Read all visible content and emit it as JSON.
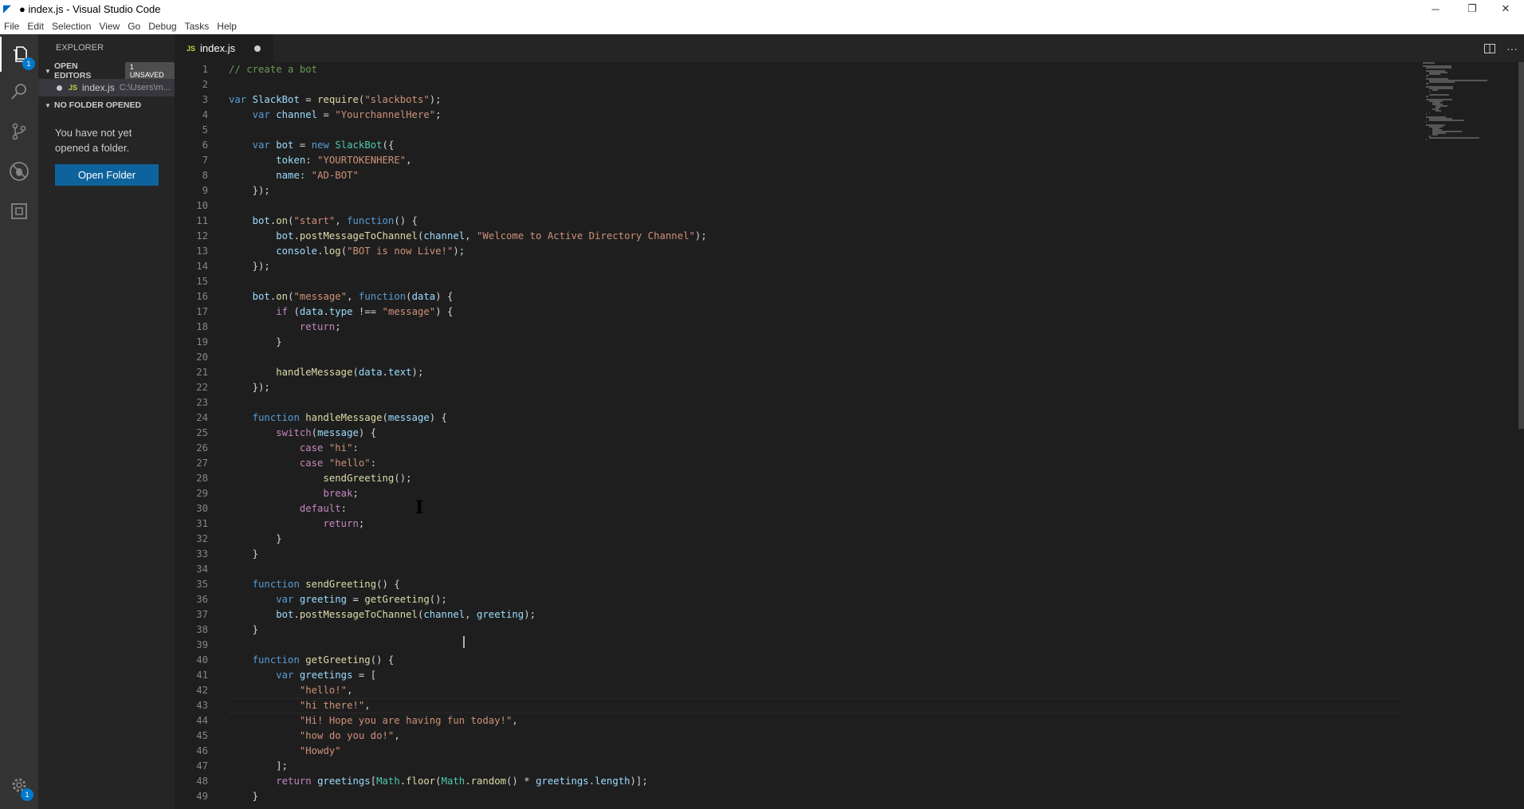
{
  "window": {
    "title": "● index.js - Visual Studio Code",
    "controls": {
      "minimize": "─",
      "maximize": "❐",
      "close": "✕"
    }
  },
  "menu": [
    "File",
    "Edit",
    "Selection",
    "View",
    "Go",
    "Debug",
    "Tasks",
    "Help"
  ],
  "activity_bar": {
    "items": [
      "files-icon",
      "search-icon",
      "source-control-icon",
      "debug-icon",
      "extensions-icon"
    ],
    "explorer_badge": "1",
    "settings_badge": "1"
  },
  "sidebar": {
    "title": "EXPLORER",
    "open_editors_label": "OPEN EDITORS",
    "unsaved_badge": "1 UNSAVED",
    "open_file": {
      "badge": "JS",
      "name": "index.js",
      "path": "C:\\Users\\m..."
    },
    "no_folder_label": "NO FOLDER OPENED",
    "no_folder_message": "You have not yet opened a folder.",
    "open_folder_button": "Open Folder"
  },
  "tab": {
    "badge": "JS",
    "name": "index.js"
  },
  "editor": {
    "lines": [
      [
        [
          "c-comment",
          "// create a bot"
        ]
      ],
      [],
      [
        [
          "c-kw",
          "var "
        ],
        [
          "c-var",
          "SlackBot"
        ],
        [
          "",
          " = "
        ],
        [
          "c-fn",
          "require"
        ],
        [
          "",
          "("
        ],
        [
          "c-str",
          "\"slackbots\""
        ],
        [
          "",
          ");"
        ]
      ],
      [
        [
          "",
          "    "
        ],
        [
          "c-kw",
          "var "
        ],
        [
          "c-var",
          "channel"
        ],
        [
          "",
          " = "
        ],
        [
          "c-str",
          "\"YourchannelHere\""
        ],
        [
          "",
          ";"
        ]
      ],
      [],
      [
        [
          "",
          "    "
        ],
        [
          "c-kw",
          "var "
        ],
        [
          "c-var",
          "bot"
        ],
        [
          "",
          " = "
        ],
        [
          "c-kw",
          "new "
        ],
        [
          "c-type",
          "SlackBot"
        ],
        [
          "",
          "({"
        ]
      ],
      [
        [
          "",
          "        "
        ],
        [
          "c-var",
          "token"
        ],
        [
          "",
          ": "
        ],
        [
          "c-str",
          "\"YOURTOKENHERE\""
        ],
        [
          "",
          ","
        ]
      ],
      [
        [
          "",
          "        "
        ],
        [
          "c-var",
          "name"
        ],
        [
          "",
          ": "
        ],
        [
          "c-str",
          "\"AD-BOT\""
        ]
      ],
      [
        [
          "",
          "    });"
        ]
      ],
      [],
      [
        [
          "",
          "    "
        ],
        [
          "c-var",
          "bot"
        ],
        [
          "",
          "."
        ],
        [
          "c-fn",
          "on"
        ],
        [
          "",
          "("
        ],
        [
          "c-str",
          "\"start\""
        ],
        [
          "",
          ", "
        ],
        [
          "c-kw",
          "function"
        ],
        [
          "",
          "() {"
        ]
      ],
      [
        [
          "",
          "        "
        ],
        [
          "c-var",
          "bot"
        ],
        [
          "",
          "."
        ],
        [
          "c-fn",
          "postMessageToChannel"
        ],
        [
          "",
          "("
        ],
        [
          "c-var",
          "channel"
        ],
        [
          "",
          ", "
        ],
        [
          "c-str",
          "\"Welcome to Active Directory Channel\""
        ],
        [
          "",
          ");"
        ]
      ],
      [
        [
          "",
          "        "
        ],
        [
          "c-var",
          "console"
        ],
        [
          "",
          "."
        ],
        [
          "c-fn",
          "log"
        ],
        [
          "",
          "("
        ],
        [
          "c-str",
          "\"BOT is now Live!\""
        ],
        [
          "",
          ");"
        ]
      ],
      [
        [
          "",
          "    });"
        ]
      ],
      [],
      [
        [
          "",
          "    "
        ],
        [
          "c-var",
          "bot"
        ],
        [
          "",
          "."
        ],
        [
          "c-fn",
          "on"
        ],
        [
          "",
          "("
        ],
        [
          "c-str",
          "\"message\""
        ],
        [
          "",
          ", "
        ],
        [
          "c-kw",
          "function"
        ],
        [
          "",
          "("
        ],
        [
          "c-var",
          "data"
        ],
        [
          "",
          ") {"
        ]
      ],
      [
        [
          "",
          "        "
        ],
        [
          "c-ctrl",
          "if"
        ],
        [
          "",
          " ("
        ],
        [
          "c-var",
          "data"
        ],
        [
          "",
          "."
        ],
        [
          "c-var",
          "type"
        ],
        [
          "",
          " !== "
        ],
        [
          "c-str",
          "\"message\""
        ],
        [
          "",
          ") {"
        ]
      ],
      [
        [
          "",
          "            "
        ],
        [
          "c-ctrl",
          "return"
        ],
        [
          "",
          ";"
        ]
      ],
      [
        [
          "",
          "        }"
        ]
      ],
      [],
      [
        [
          "",
          "        "
        ],
        [
          "c-fn",
          "handleMessage"
        ],
        [
          "",
          "("
        ],
        [
          "c-var",
          "data"
        ],
        [
          "",
          "."
        ],
        [
          "c-var",
          "text"
        ],
        [
          "",
          ");"
        ]
      ],
      [
        [
          "",
          "    });"
        ]
      ],
      [],
      [
        [
          "",
          "    "
        ],
        [
          "c-kw",
          "function "
        ],
        [
          "c-fn",
          "handleMessage"
        ],
        [
          "",
          "("
        ],
        [
          "c-var",
          "message"
        ],
        [
          "",
          ") {"
        ]
      ],
      [
        [
          "",
          "        "
        ],
        [
          "c-ctrl",
          "switch"
        ],
        [
          "",
          "("
        ],
        [
          "c-var",
          "message"
        ],
        [
          "",
          ") {"
        ]
      ],
      [
        [
          "",
          "            "
        ],
        [
          "c-ctrl",
          "case "
        ],
        [
          "c-str",
          "\"hi\""
        ],
        [
          "",
          ":"
        ]
      ],
      [
        [
          "",
          "            "
        ],
        [
          "c-ctrl",
          "case "
        ],
        [
          "c-str",
          "\"hello\""
        ],
        [
          "",
          ":"
        ]
      ],
      [
        [
          "",
          "                "
        ],
        [
          "c-fn",
          "sendGreeting"
        ],
        [
          "",
          "();"
        ]
      ],
      [
        [
          "",
          "                "
        ],
        [
          "c-ctrl",
          "break"
        ],
        [
          "",
          ";"
        ]
      ],
      [
        [
          "",
          "            "
        ],
        [
          "c-ctrl",
          "default"
        ],
        [
          "",
          ":"
        ]
      ],
      [
        [
          "",
          "                "
        ],
        [
          "c-ctrl",
          "return"
        ],
        [
          "",
          ";"
        ]
      ],
      [
        [
          "",
          "        }"
        ]
      ],
      [
        [
          "",
          "    }"
        ]
      ],
      [],
      [
        [
          "",
          "    "
        ],
        [
          "c-kw",
          "function "
        ],
        [
          "c-fn",
          "sendGreeting"
        ],
        [
          "",
          "() {"
        ]
      ],
      [
        [
          "",
          "        "
        ],
        [
          "c-kw",
          "var "
        ],
        [
          "c-var",
          "greeting"
        ],
        [
          "",
          " = "
        ],
        [
          "c-fn",
          "getGreeting"
        ],
        [
          "",
          "();"
        ]
      ],
      [
        [
          "",
          "        "
        ],
        [
          "c-var",
          "bot"
        ],
        [
          "",
          "."
        ],
        [
          "c-fn",
          "postMessageToChannel"
        ],
        [
          "",
          "("
        ],
        [
          "c-var",
          "channel"
        ],
        [
          "",
          ", "
        ],
        [
          "c-var",
          "greeting"
        ],
        [
          "",
          ");"
        ]
      ],
      [
        [
          "",
          "    }"
        ]
      ],
      [],
      [
        [
          "",
          "    "
        ],
        [
          "c-kw",
          "function "
        ],
        [
          "c-fn",
          "getGreeting"
        ],
        [
          "",
          "() {"
        ]
      ],
      [
        [
          "",
          "        "
        ],
        [
          "c-kw",
          "var "
        ],
        [
          "c-var",
          "greetings"
        ],
        [
          "",
          " = ["
        ]
      ],
      [
        [
          "",
          "            "
        ],
        [
          "c-str",
          "\"hello!\""
        ],
        [
          "",
          ","
        ]
      ],
      [
        [
          "",
          "            "
        ],
        [
          "c-str",
          "\"hi there!\""
        ],
        [
          "",
          ","
        ]
      ],
      [
        [
          "",
          "            "
        ],
        [
          "c-str",
          "\"Hi! Hope you are having fun today!\""
        ],
        [
          "",
          ","
        ]
      ],
      [
        [
          "",
          "            "
        ],
        [
          "c-str",
          "\"how do you do!\""
        ],
        [
          "",
          ","
        ]
      ],
      [
        [
          "",
          "            "
        ],
        [
          "c-str",
          "\"Howdy\""
        ]
      ],
      [
        [
          "",
          "        ];"
        ]
      ],
      [
        [
          "",
          "        "
        ],
        [
          "c-ctrl",
          "return "
        ],
        [
          "c-var",
          "greetings"
        ],
        [
          "",
          "["
        ],
        [
          "c-type",
          "Math"
        ],
        [
          "",
          "."
        ],
        [
          "c-fn",
          "floor"
        ],
        [
          "",
          "("
        ],
        [
          "c-type",
          "Math"
        ],
        [
          "",
          "."
        ],
        [
          "c-fn",
          "random"
        ],
        [
          "",
          "() * "
        ],
        [
          "c-var",
          "greetings"
        ],
        [
          "",
          "."
        ],
        [
          "c-var",
          "length"
        ],
        [
          "",
          ")];"
        ]
      ],
      [
        [
          "",
          "    }"
        ]
      ]
    ]
  },
  "colors": {
    "accent": "#007acc",
    "button": "#0e639c",
    "editor_bg": "#1e1e1e",
    "sidebar_bg": "#252526",
    "activity_bg": "#333333"
  }
}
